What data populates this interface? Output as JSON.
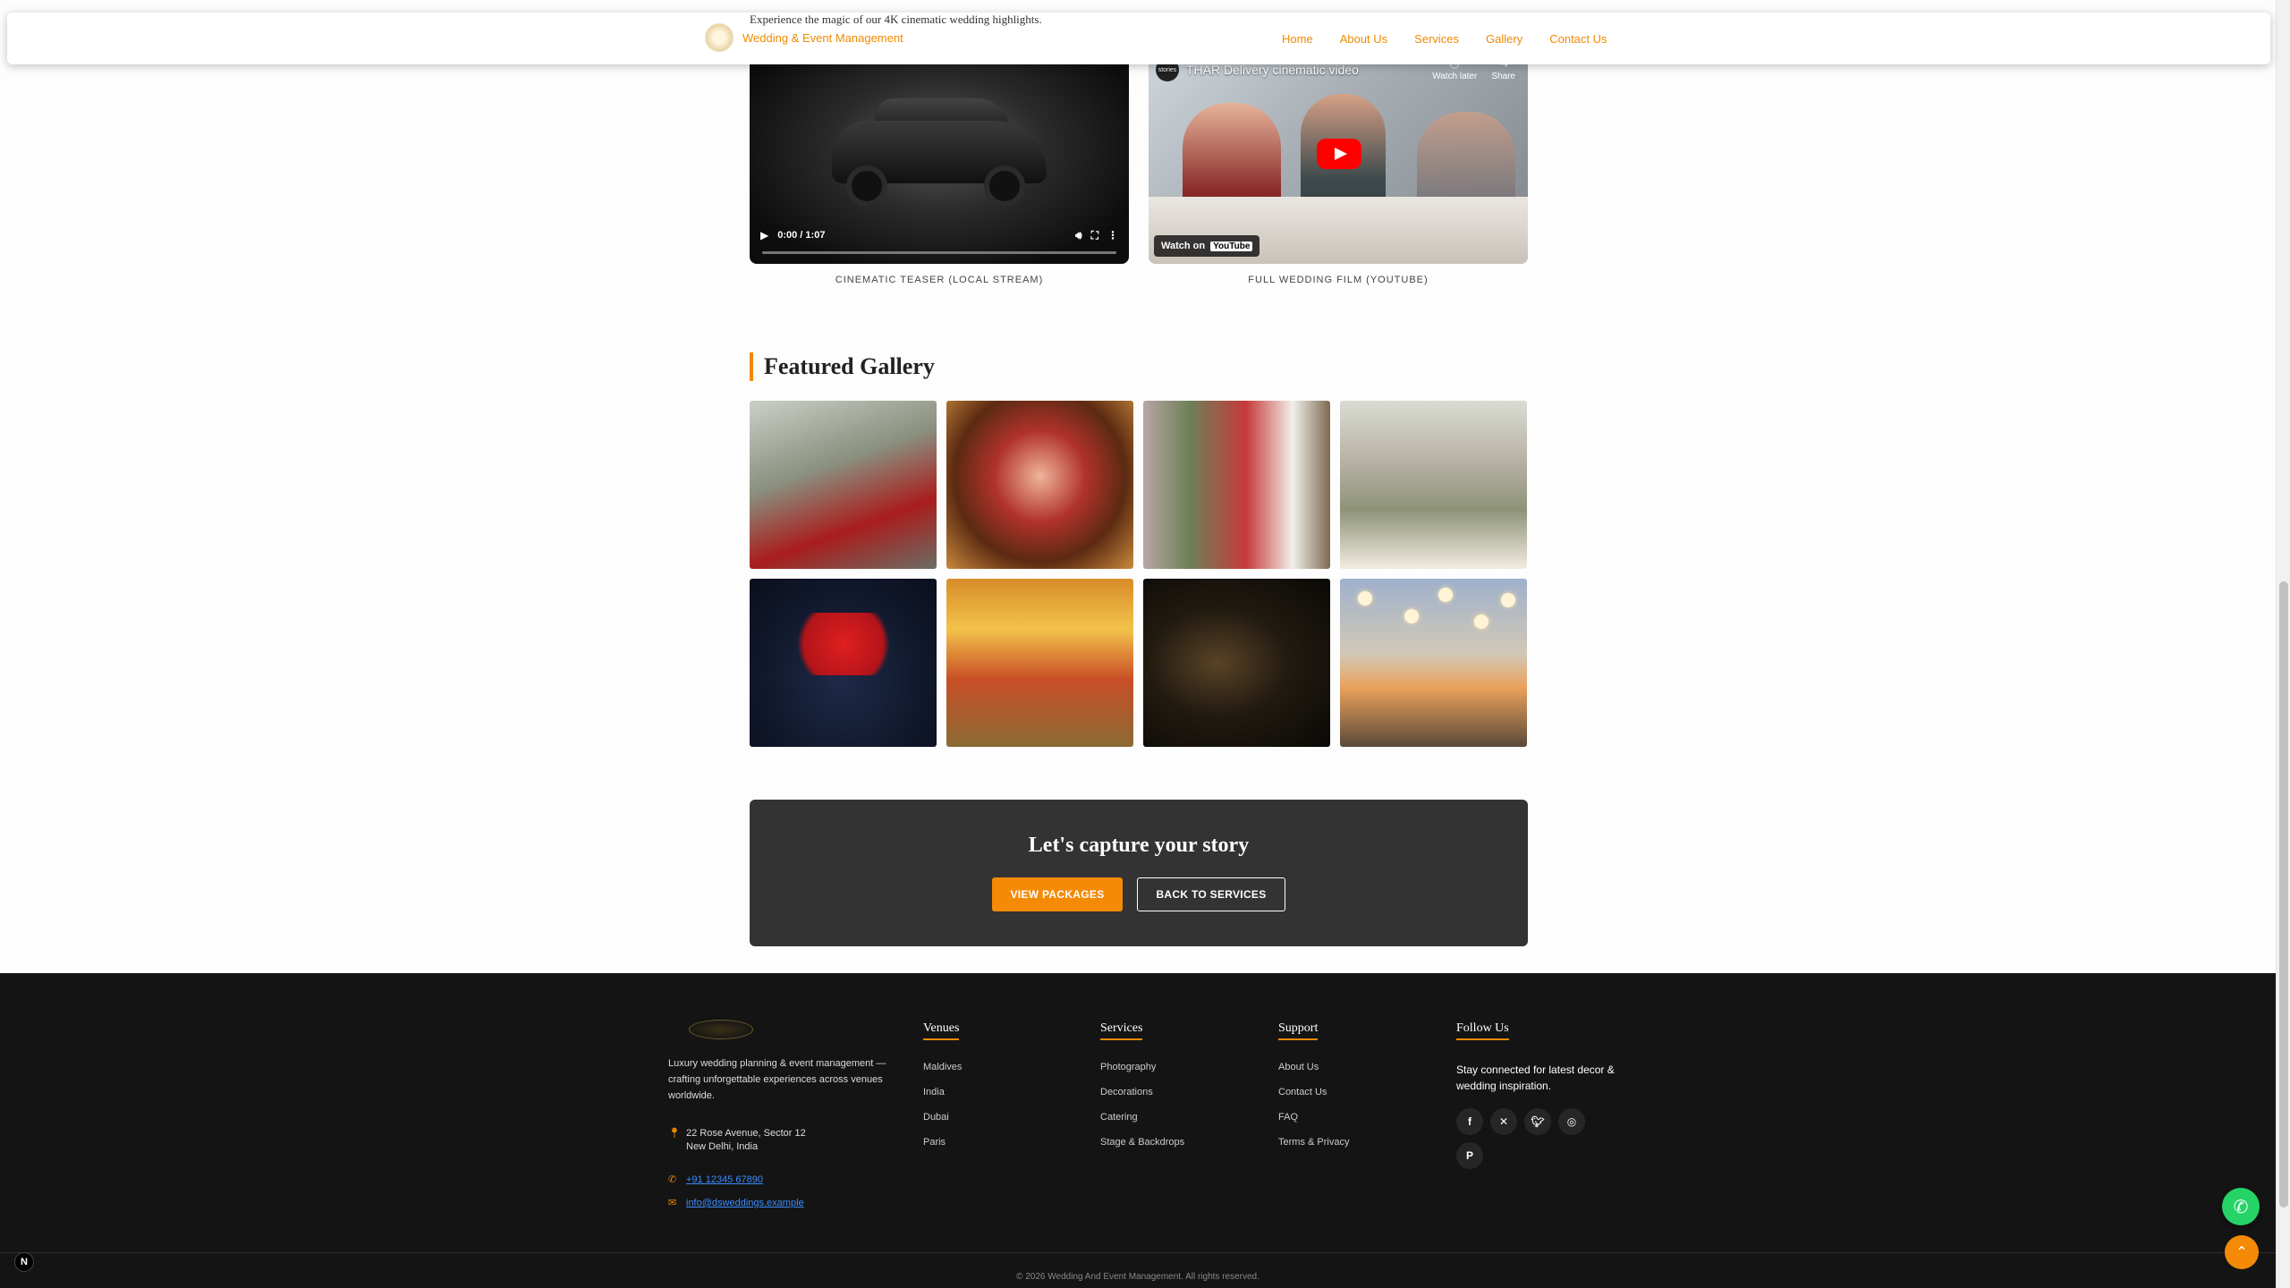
{
  "nav": {
    "brand": "Wedding & Event Management",
    "links": [
      "Home",
      "About Us",
      "Services",
      "Gallery",
      "Contact Us"
    ]
  },
  "intro": "Experience the magic of our 4K cinematic wedding highlights.",
  "videos": {
    "local": {
      "time": "0:00 / 1:07",
      "caption": "CINEMATIC TEASER (LOCAL STREAM)"
    },
    "youtube": {
      "channel": "stories",
      "title": "THAR Delivery cinematic video",
      "watch_later": "Watch later",
      "share": "Share",
      "watch_on": "Watch on",
      "yt_brand": "YouTube",
      "caption": "FULL WEDDING FILM (YOUTUBE)"
    }
  },
  "gallery": {
    "title": "Featured Gallery",
    "images": [
      "bride-groom-garden",
      "bride-portrait",
      "mandap-decor",
      "floral-arch",
      "decorated-car",
      "ceremony-stage",
      "fairy-lights",
      "lantern-reception"
    ]
  },
  "cta": {
    "title": "Let's capture your story",
    "primary": "VIEW PACKAGES",
    "secondary": "BACK TO SERVICES"
  },
  "footer": {
    "about": "Luxury wedding planning & event management — crafting unforgettable experiences across venues worldwide.",
    "address_line1": "22 Rose Avenue, Sector 12",
    "address_line2": "New Delhi, India",
    "phone": "+91 12345 67890",
    "email": "info@dsweddings.example",
    "venues": {
      "title": "Venues",
      "items": [
        "Maldives",
        "India",
        "Dubai",
        "Paris"
      ]
    },
    "services": {
      "title": "Services",
      "items": [
        "Photography",
        "Decorations",
        "Catering",
        "Stage & Backdrops"
      ]
    },
    "support": {
      "title": "Support",
      "items": [
        "About Us",
        "Contact Us",
        "FAQ",
        "Terms & Privacy"
      ]
    },
    "follow": {
      "title": "Follow Us",
      "text": "Stay connected for latest decor & wedding inspiration."
    },
    "copyright": "© 2026 Wedding And Event Management. All rights reserved."
  },
  "icons": {
    "socials": [
      "facebook-icon",
      "x-icon",
      "twitter-icon",
      "instagram-icon",
      "pinterest-icon"
    ],
    "accent": "#f08a00"
  }
}
